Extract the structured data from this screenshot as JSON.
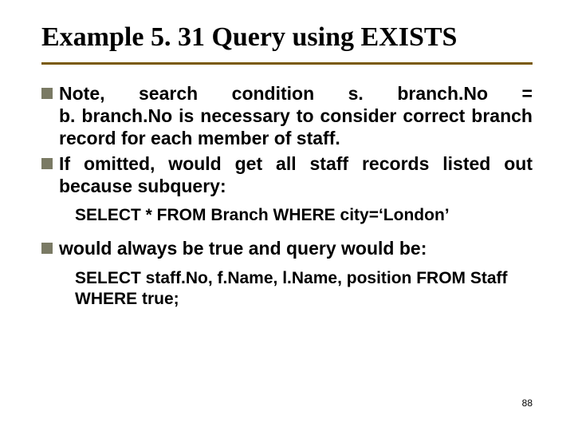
{
  "slide": {
    "title": "Example 5. 31  Query using EXISTS",
    "bullets": [
      {
        "line1": "Note,    search    condition    s. branch.No    =",
        "rest": "b. branch.No is necessary to consider correct branch record for each member of staff."
      },
      {
        "text": "If omitted, would get all staff records listed out because subquery:"
      },
      {
        "text": "would always be true and query would be:"
      }
    ],
    "code1": "SELECT * FROM Branch WHERE city=‘London’",
    "code2_line1": "SELECT staff.No, f.Name, l.Name, position FROM Staff",
    "code2_line2": "WHERE true;",
    "page_number": "88"
  }
}
